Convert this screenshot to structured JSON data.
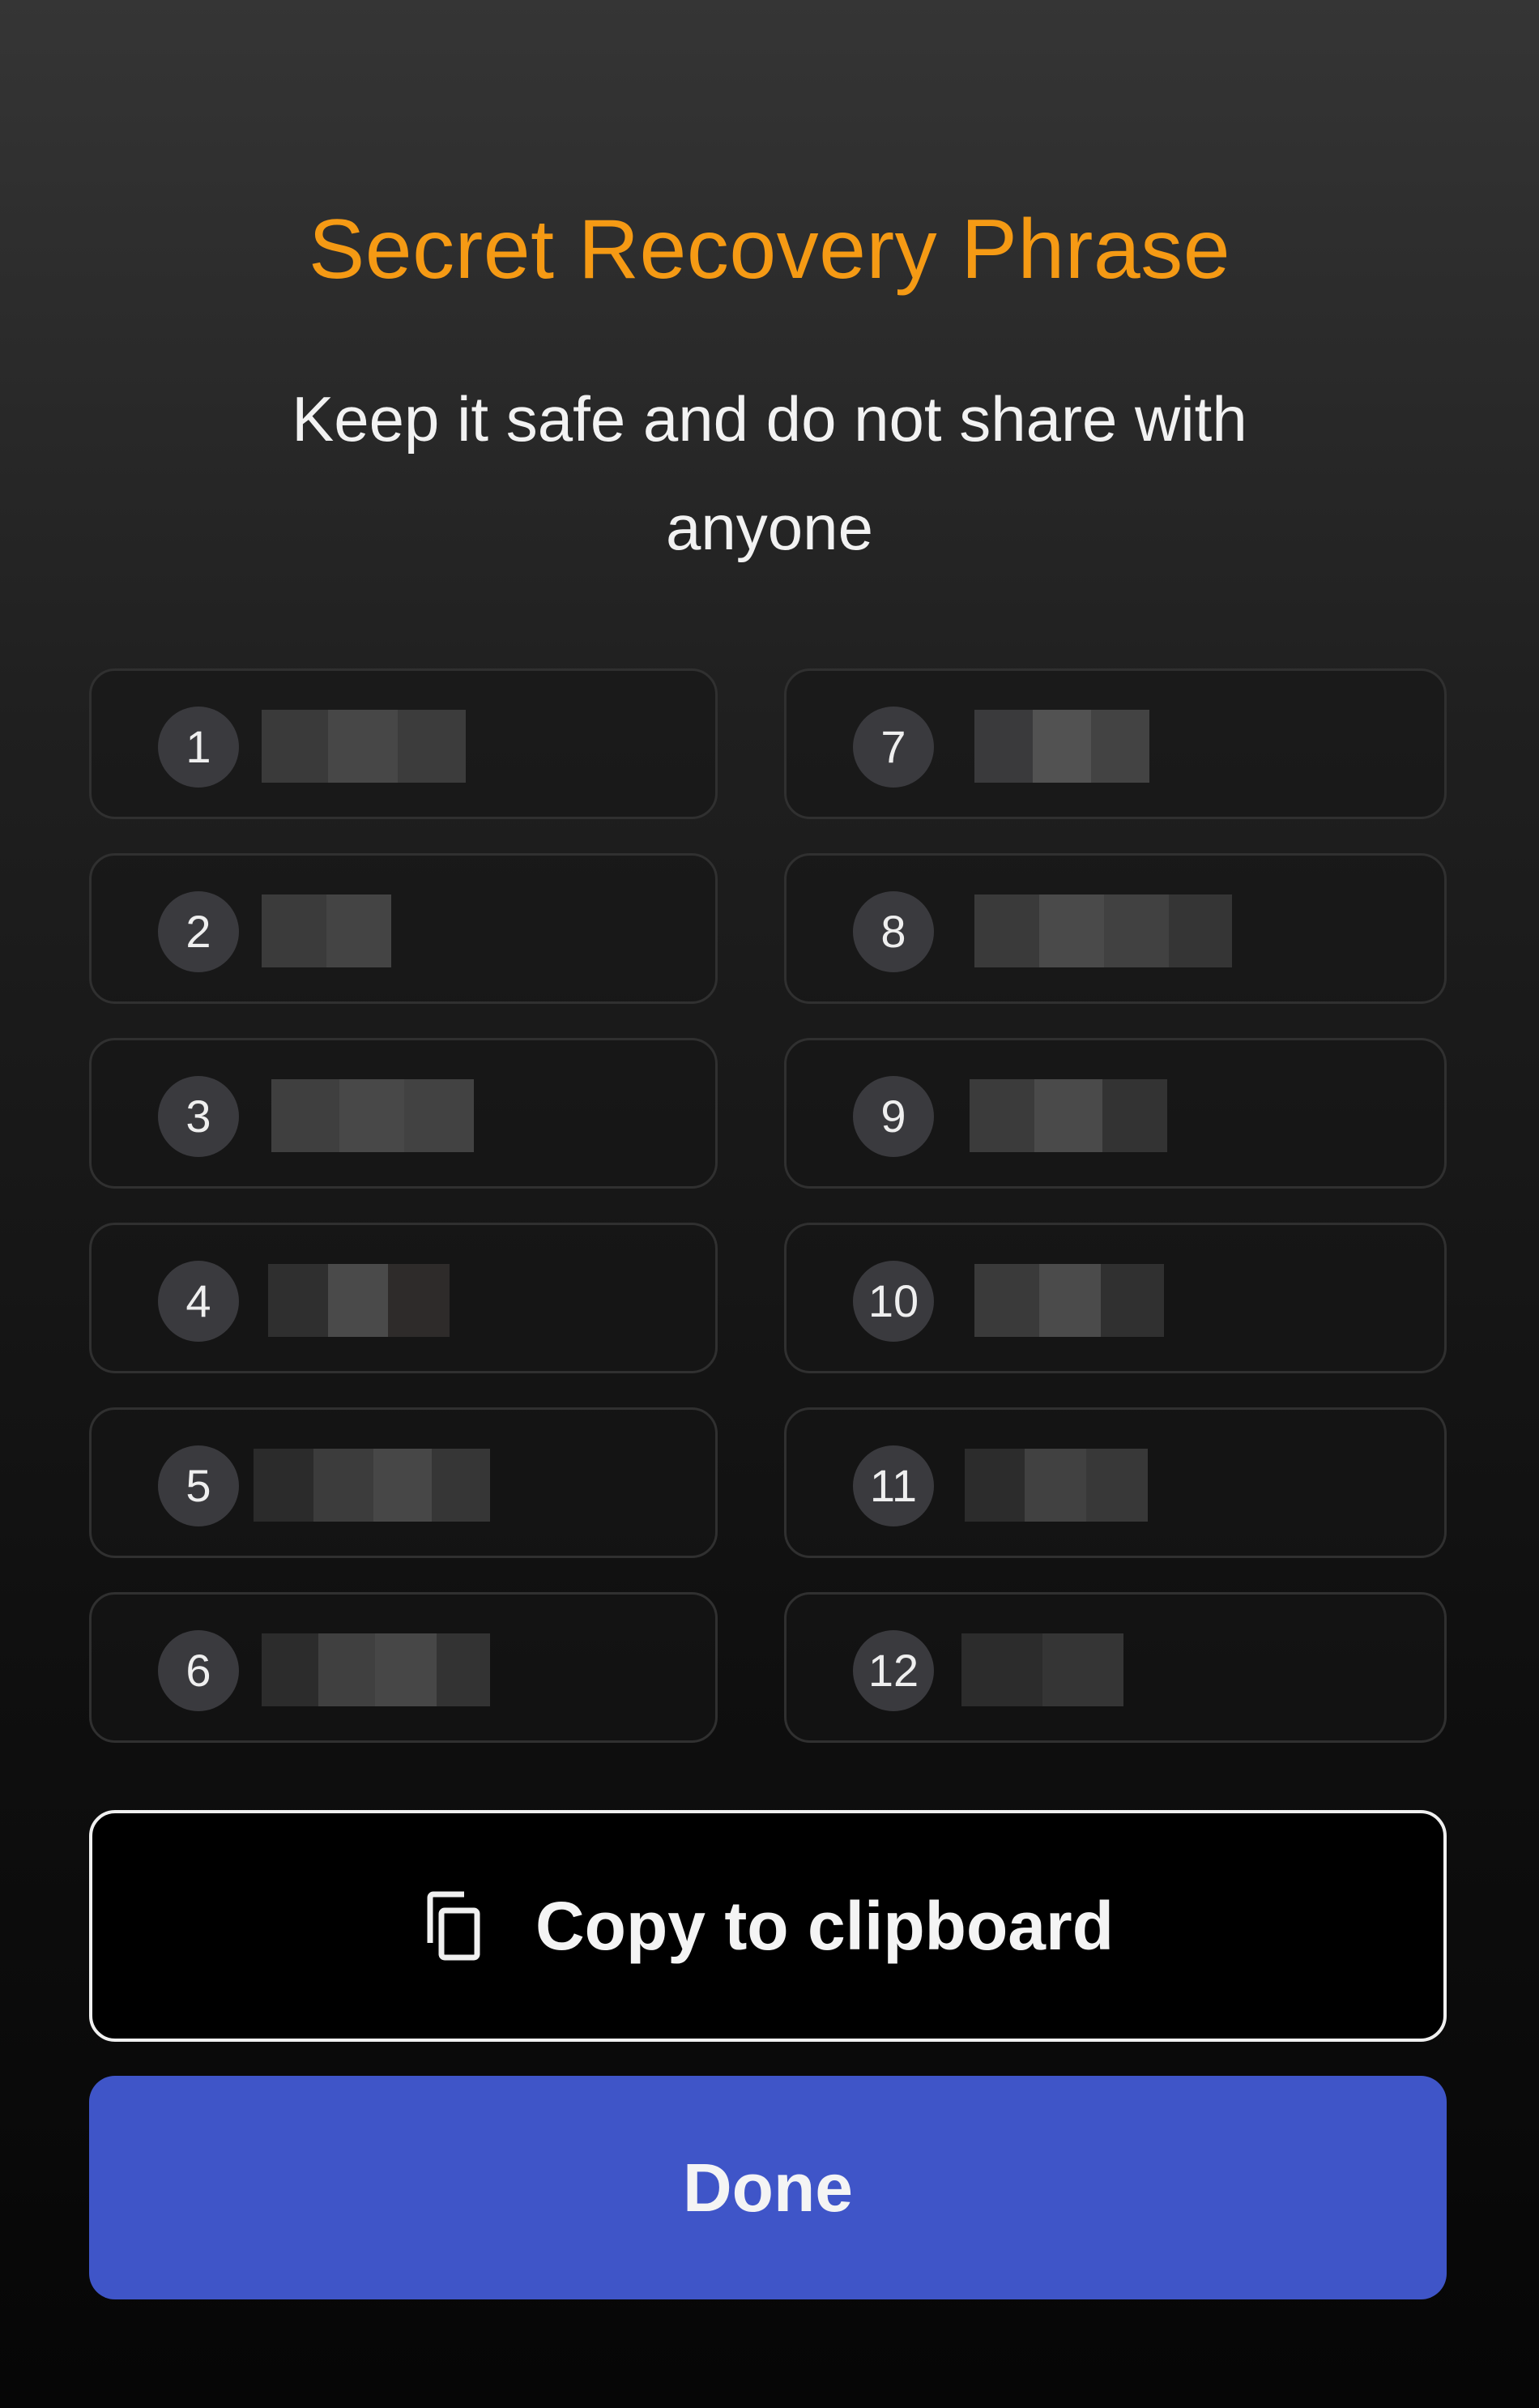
{
  "header": {
    "title": "Secret Recovery Phrase",
    "subtitle": "Keep it safe and do not share with anyone"
  },
  "colors": {
    "title": "#f59a14",
    "primary_button": "#3f55c8"
  },
  "phrase": {
    "words": [
      {
        "number": "1",
        "masked": true
      },
      {
        "number": "2",
        "masked": true
      },
      {
        "number": "3",
        "masked": true
      },
      {
        "number": "4",
        "masked": true
      },
      {
        "number": "5",
        "masked": true
      },
      {
        "number": "6",
        "masked": true
      },
      {
        "number": "7",
        "masked": true
      },
      {
        "number": "8",
        "masked": true
      },
      {
        "number": "9",
        "masked": true
      },
      {
        "number": "10",
        "masked": true
      },
      {
        "number": "11",
        "masked": true
      },
      {
        "number": "12",
        "masked": true
      }
    ]
  },
  "actions": {
    "copy_label": "Copy to clipboard",
    "copy_icon": "copy-icon",
    "done_label": "Done"
  }
}
